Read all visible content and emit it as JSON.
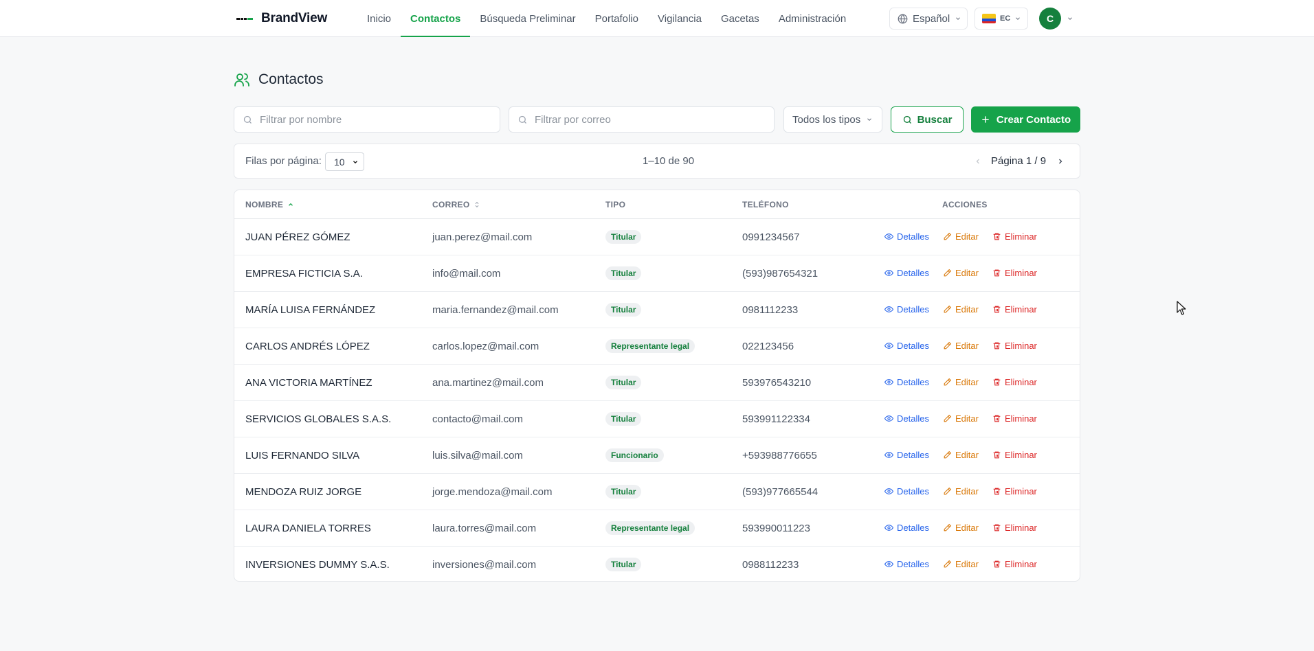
{
  "brand": {
    "name": "BrandView"
  },
  "nav": {
    "items": [
      {
        "label": "Inicio",
        "active": false
      },
      {
        "label": "Contactos",
        "active": true
      },
      {
        "label": "Búsqueda Preliminar",
        "active": false
      },
      {
        "label": "Portafolio",
        "active": false
      },
      {
        "label": "Vigilancia",
        "active": false
      },
      {
        "label": "Gacetas",
        "active": false
      },
      {
        "label": "Administración",
        "active": false
      }
    ],
    "language": "Español",
    "country": "EC",
    "avatar_initial": "C"
  },
  "page": {
    "title": "Contactos"
  },
  "filters": {
    "name_placeholder": "Filtrar por nombre",
    "email_placeholder": "Filtrar por correo",
    "type_select": "Todos los tipos",
    "search_label": "Buscar",
    "create_label": "Crear Contacto"
  },
  "pagination": {
    "rows_label": "Filas por página:",
    "rows_value": "10",
    "range": "1–10 de 90",
    "page": "Página 1 / 9"
  },
  "table": {
    "headers": {
      "name": "NOMBRE",
      "email": "CORREO",
      "type": "TIPO",
      "phone": "TELÉFONO",
      "actions": "ACCIONES"
    },
    "action_labels": {
      "details": "Detalles",
      "edit": "Editar",
      "delete": "Eliminar"
    },
    "rows": [
      {
        "name": "JUAN PÉREZ GÓMEZ",
        "email": "juan.perez@mail.com",
        "type": "Titular",
        "phone": "0991234567"
      },
      {
        "name": "EMPRESA FICTICIA S.A.",
        "email": "info@mail.com",
        "type": "Titular",
        "phone": "(593)987654321"
      },
      {
        "name": "MARÍA LUISA FERNÁNDEZ",
        "email": "maria.fernandez@mail.com",
        "type": "Titular",
        "phone": "0981112233"
      },
      {
        "name": "CARLOS ANDRÉS LÓPEZ",
        "email": "carlos.lopez@mail.com",
        "type": "Representante legal",
        "phone": "022123456"
      },
      {
        "name": "ANA VICTORIA MARTÍNEZ",
        "email": "ana.martinez@mail.com",
        "type": "Titular",
        "phone": "593976543210"
      },
      {
        "name": "SERVICIOS GLOBALES S.A.S.",
        "email": "contacto@mail.com",
        "type": "Titular",
        "phone": "593991122334"
      },
      {
        "name": "LUIS FERNANDO SILVA",
        "email": "luis.silva@mail.com",
        "type": "Funcionario",
        "phone": "+593988776655"
      },
      {
        "name": "MENDOZA RUIZ JORGE",
        "email": "jorge.mendoza@mail.com",
        "type": "Titular",
        "phone": "(593)977665544"
      },
      {
        "name": "LAURA DANIELA TORRES",
        "email": "laura.torres@mail.com",
        "type": "Representante legal",
        "phone": "593990011223"
      },
      {
        "name": "INVERSIONES DUMMY S.A.S.",
        "email": "inversiones@mail.com",
        "type": "Titular",
        "phone": "0988112233"
      }
    ]
  },
  "colors": {
    "accent": "#16a34a",
    "details": "#2563eb",
    "edit": "#d97706",
    "delete": "#dc2626"
  }
}
